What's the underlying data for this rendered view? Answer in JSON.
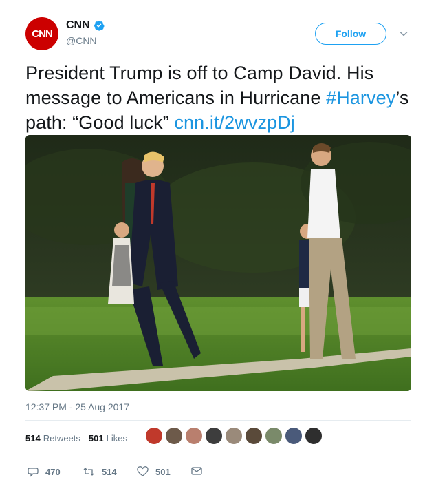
{
  "account": {
    "logo_text": "CNN",
    "name": "CNN",
    "handle": "@CNN",
    "verified_icon": "verified-badge-icon",
    "brand_color": "#cc0000"
  },
  "follow_button": {
    "label": "Follow"
  },
  "tweet": {
    "text_part1": "President Trump is off to Camp David. His message to Americans in Hurricane ",
    "hashtag": "#Harvey",
    "text_part2": "’s path: “Good luck” ",
    "link": "cnn.it/2wvzpDj",
    "timestamp": "12:37 PM - 25 Aug 2017"
  },
  "stats": {
    "retweets_count": "514",
    "retweets_label": "Retweets",
    "likes_count": "501",
    "likes_label": "Likes"
  },
  "actions": {
    "replies": "470",
    "retweets": "514",
    "likes": "501"
  },
  "colors": {
    "accent": "#1da1f2",
    "link": "#1b95e0",
    "muted": "#657786"
  }
}
